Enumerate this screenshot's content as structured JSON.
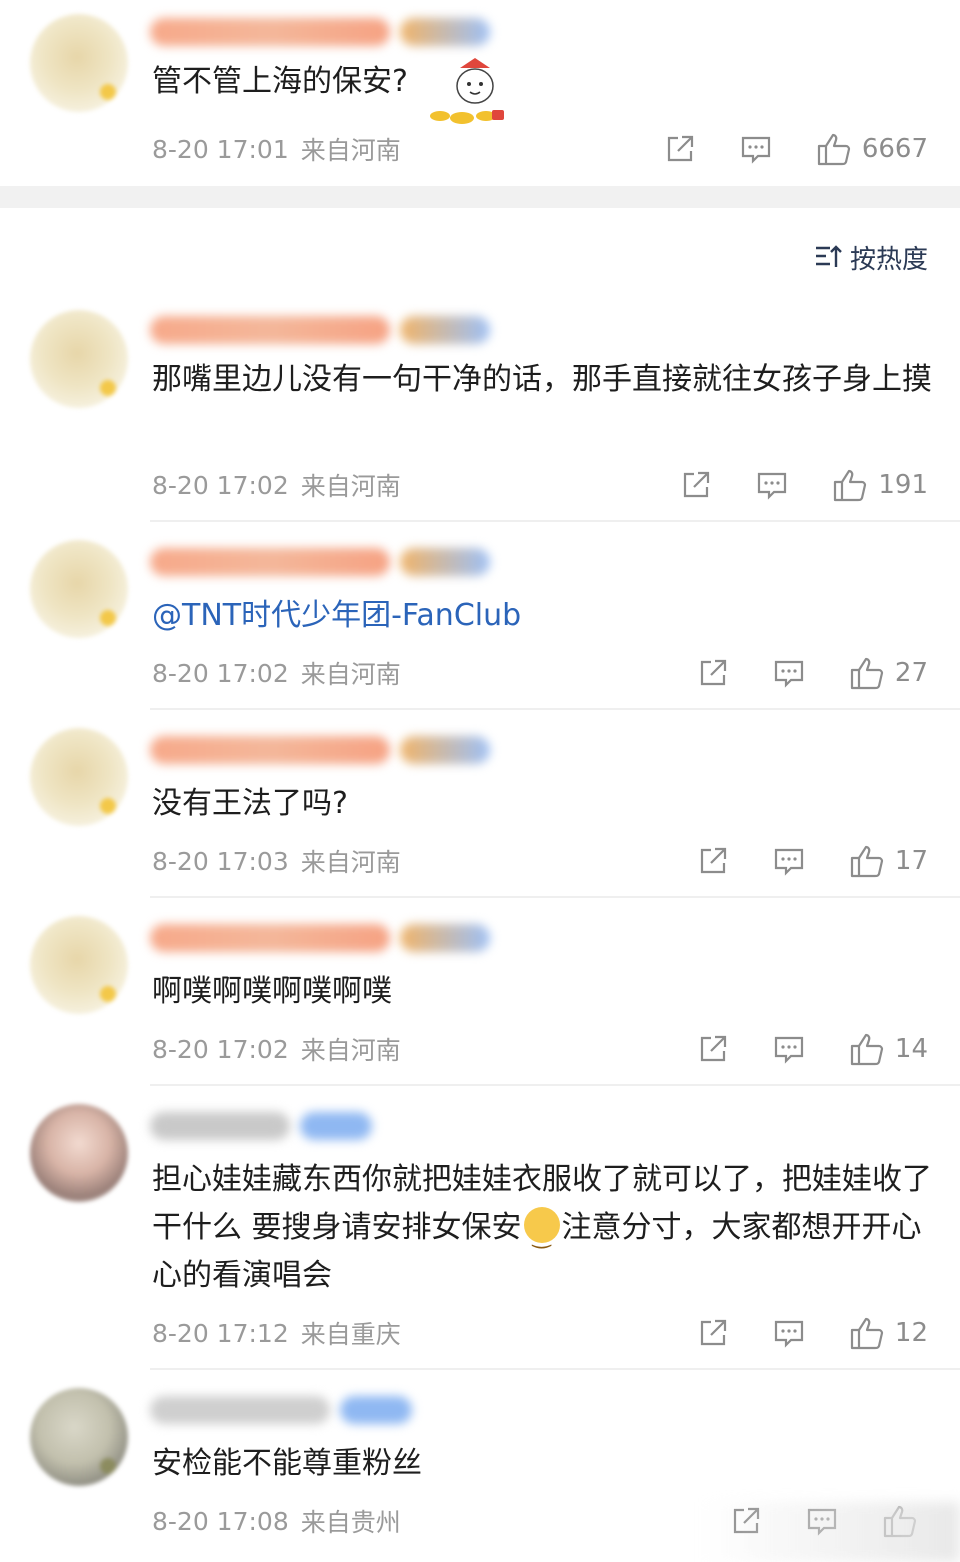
{
  "top_comment": {
    "text": "管不管上海的保安?",
    "time": "8-20 17:01",
    "location": "来自河南",
    "likes": "6667"
  },
  "sort": {
    "label": "按热度"
  },
  "replies": [
    {
      "text": "那嘴里边儿没有一句干净的话，那手直接就往女孩子身上摸",
      "time": "8-20 17:02",
      "location": "来自河南",
      "likes": "191"
    },
    {
      "text": "@TNT时代少年团-FanClub",
      "time": "8-20 17:02",
      "location": "来自河南",
      "likes": "27"
    },
    {
      "text": "没有王法了吗?",
      "time": "8-20 17:03",
      "location": "来自河南",
      "likes": "17"
    },
    {
      "text": "啊噗啊噗啊噗啊噗",
      "time": "8-20 17:02",
      "location": "来自河南",
      "likes": "14"
    },
    {
      "text_part1": "担心娃娃藏东西你就把娃娃衣服收了就可以了，把娃娃收了干什么 要搜身请安排女保安",
      "text_part2": "注意分寸，大家都想开开心心的看演唱会",
      "time": "8-20 17:12",
      "location": "来自重庆",
      "likes": "12"
    },
    {
      "text": "安检能不能尊重粉丝",
      "time": "8-20 17:08",
      "location": "来自贵州",
      "likes": ""
    }
  ],
  "icons": {
    "share": "share-icon",
    "comment": "comment-icon",
    "like": "thumbs-up-icon",
    "sort": "sort-icon",
    "emoji": "smile-emoji-icon"
  },
  "colors": {
    "link": "#2b64b9",
    "meta": "#9a9a9a",
    "text": "#1e1e1e"
  }
}
